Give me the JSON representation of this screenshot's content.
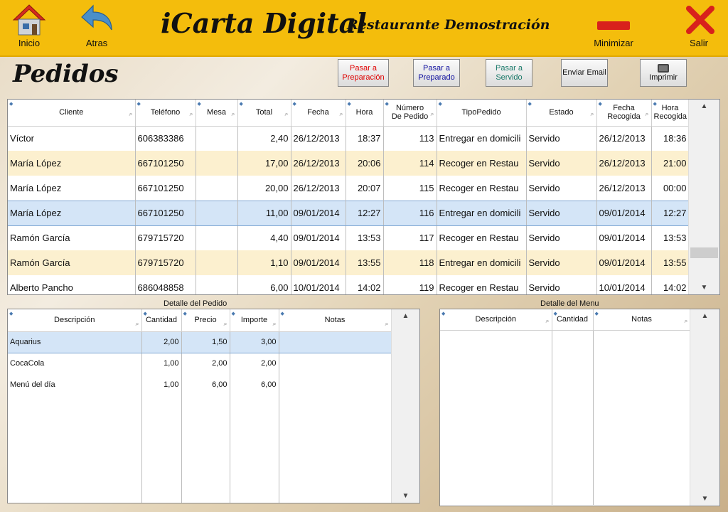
{
  "header": {
    "inicio_label": "Inicio",
    "atras_label": "Atras",
    "logo_text": "iCarta Digital",
    "restaurant_name": "Restaurante Demostración",
    "minimizar_label": "Minimizar",
    "salir_label": "Salir"
  },
  "page_title": "Pedidos",
  "actions": {
    "pasar_preparacion": "Pasar a Preparación",
    "pasar_preparado": "Pasar a Preparado",
    "pasar_servido": "Pasar a Servido",
    "enviar_email": "Enviar Email",
    "imprimir": "Imprimir"
  },
  "colors": {
    "header_bg": "#f4bd0c",
    "alt_row": "#fcf0cf",
    "selected_row": "#d4e5f7",
    "preparacion_text": "#e00000",
    "preparado_text": "#1010a0",
    "servido_text": "#1a7a6a"
  },
  "orders": {
    "columns": [
      "Cliente",
      "Teléfono",
      "Mesa",
      "Total",
      "Fecha",
      "Hora",
      "Número De Pedido",
      "TipoPedido",
      "Estado",
      "Fecha Recogida",
      "Hora Recogida"
    ],
    "rows": [
      [
        "Víctor",
        "606383386",
        "",
        "2,40",
        "26/12/2013",
        "18:37",
        "113",
        "Entregar en domicili",
        "Servido",
        "26/12/2013",
        "18:36"
      ],
      [
        "María López",
        "667101250",
        "",
        "17,00",
        "26/12/2013",
        "20:06",
        "114",
        "Recoger en Restau",
        "Servido",
        "26/12/2013",
        "21:00"
      ],
      [
        "María López",
        "667101250",
        "",
        "20,00",
        "26/12/2013",
        "20:07",
        "115",
        "Recoger en Restau",
        "Servido",
        "26/12/2013",
        "00:00"
      ],
      [
        "María López",
        "667101250",
        "",
        "11,00",
        "09/01/2014",
        "12:27",
        "116",
        "Entregar en domicili",
        "Servido",
        "09/01/2014",
        "12:27"
      ],
      [
        "Ramón García",
        "679715720",
        "",
        "4,40",
        "09/01/2014",
        "13:53",
        "117",
        "Recoger en Restau",
        "Servido",
        "09/01/2014",
        "13:53"
      ],
      [
        "Ramón García",
        "679715720",
        "",
        "1,10",
        "09/01/2014",
        "13:55",
        "118",
        "Entregar en domicili",
        "Servido",
        "09/01/2014",
        "13:55"
      ],
      [
        "Alberto Pancho",
        "686048858",
        "",
        "6,00",
        "10/01/2014",
        "14:02",
        "119",
        "Recoger en Restau",
        "Servido",
        "10/01/2014",
        "14:02"
      ]
    ]
  },
  "detalle_pedido": {
    "caption": "Detalle del Pedido",
    "columns": [
      "Descripción",
      "Cantidad",
      "Precio",
      "Importe",
      "Notas"
    ],
    "rows": [
      [
        "Aquarius",
        "2,00",
        "1,50",
        "3,00",
        ""
      ],
      [
        "CocaCola",
        "1,00",
        "2,00",
        "2,00",
        ""
      ],
      [
        "Menú del día",
        "1,00",
        "6,00",
        "6,00",
        ""
      ]
    ]
  },
  "detalle_menu": {
    "caption": "Detalle del Menu",
    "columns": [
      "Descripción",
      "Cantidad",
      "Notas"
    ]
  }
}
